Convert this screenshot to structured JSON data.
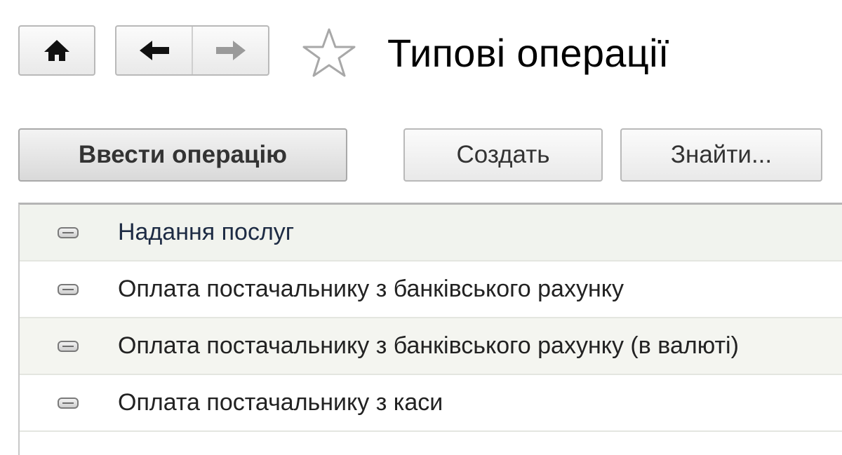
{
  "header": {
    "title": "Типові операції"
  },
  "toolbar": {
    "main_label": "Ввести операцію",
    "create_label": "Создать",
    "find_label": "Знайти..."
  },
  "list": {
    "items": [
      {
        "label": "Надання послуг"
      },
      {
        "label": "Оплата постачальнику з банківського рахунку"
      },
      {
        "label": "Оплата постачальнику з банківського рахунку (в валюті)"
      },
      {
        "label": "Оплата постачальнику з каси"
      }
    ]
  }
}
